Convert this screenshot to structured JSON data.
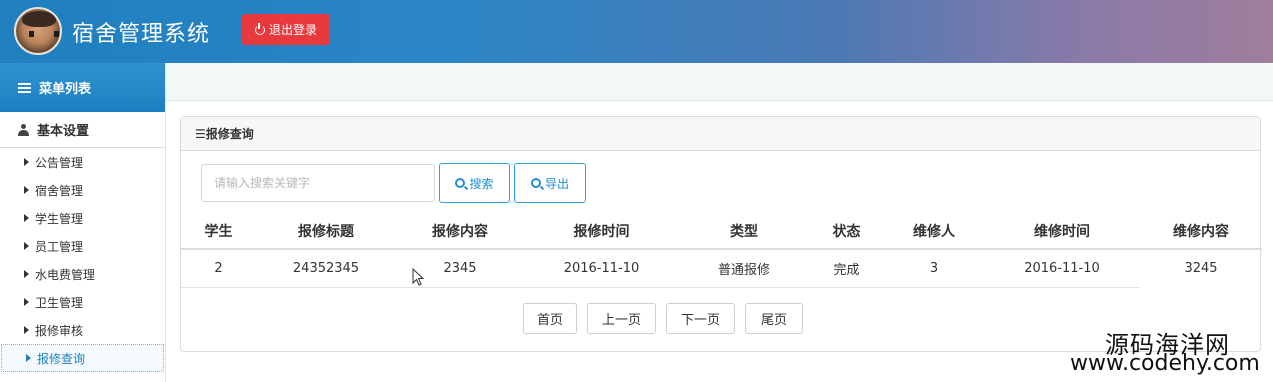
{
  "header": {
    "title": "宿舍管理系统",
    "logout_label": "退出登录"
  },
  "sidebar": {
    "menu_title": "菜单列表",
    "section_title": "基本设置",
    "items": [
      {
        "label": "公告管理"
      },
      {
        "label": "宿舍管理"
      },
      {
        "label": "学生管理"
      },
      {
        "label": "员工管理"
      },
      {
        "label": "水电费管理"
      },
      {
        "label": "卫生管理"
      },
      {
        "label": "报修审核"
      },
      {
        "label": "报修查询"
      }
    ],
    "active_item": "报修查询"
  },
  "panel": {
    "title": "☰报修查询"
  },
  "search": {
    "placeholder": "请输入搜索关键字",
    "value": "",
    "search_label": "搜索",
    "export_label": "导出"
  },
  "table": {
    "columns": [
      "学生",
      "报修标题",
      "报修内容",
      "报修时间",
      "类型",
      "状态",
      "维修人",
      "维修时间",
      "维修内容"
    ],
    "rows": [
      [
        "2",
        "24352345",
        "2345",
        "2016-11-10",
        "普通报修",
        "完成",
        "3",
        "2016-11-10",
        "3245"
      ]
    ]
  },
  "pagination": {
    "first": "首页",
    "prev": "上一页",
    "next": "下一页",
    "last": "尾页"
  },
  "watermark": {
    "cn": "源码海洋网",
    "url": "www.codehy.com"
  },
  "colors": {
    "header_start": "#1f7fbf",
    "logout_button": "#e8393f",
    "accent": "#1e8fcf"
  }
}
